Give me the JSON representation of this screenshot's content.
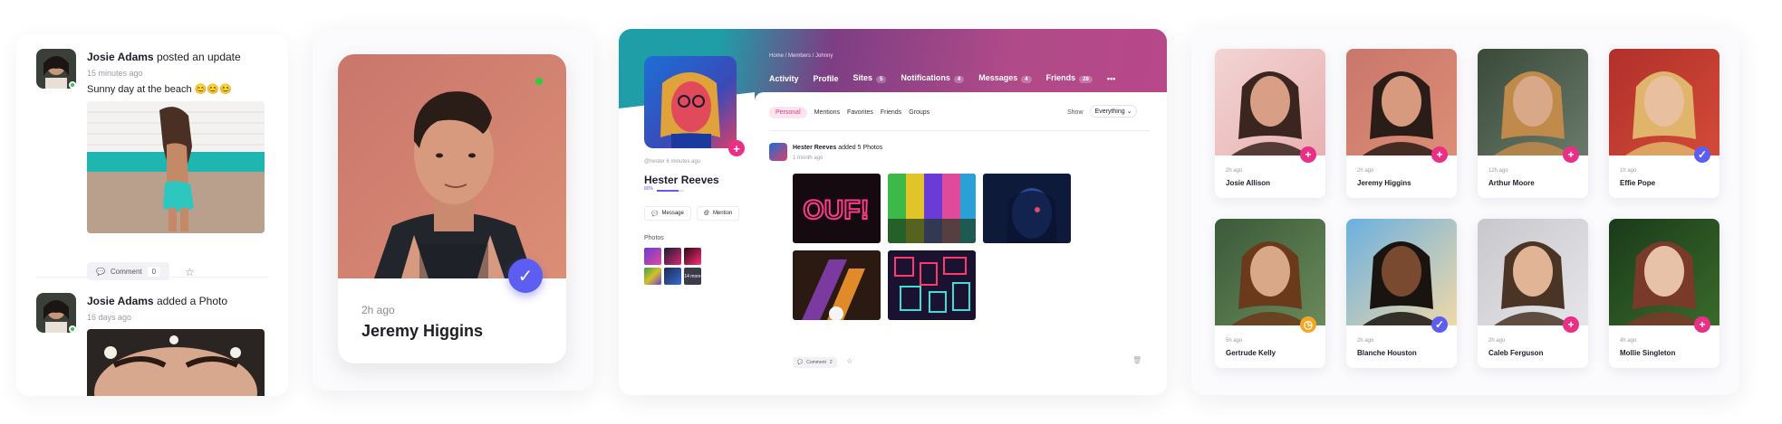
{
  "colors": {
    "accent_pink": "#ea2f86",
    "accent_blue": "#5b5ef0",
    "accent_orange": "#f5a623",
    "online": "#2ecc40"
  },
  "feed": {
    "items": [
      {
        "author": "Josie Adams",
        "action": "posted an update",
        "time": "15 minutes ago",
        "text": "Sunny day at the beach",
        "emoji": "😊😊😊",
        "comment_label": "Comment",
        "comment_count": "0"
      },
      {
        "author": "Josie Adams",
        "action": "added a Photo",
        "time": "16 days ago"
      }
    ]
  },
  "single_card": {
    "time": "2h ago",
    "name": "Jeremy Higgins",
    "badge_icon": "check-icon"
  },
  "profile": {
    "breadcrumb": "Home  /  Members  /  Johnny",
    "tabs": [
      {
        "label": "Activity",
        "count": ""
      },
      {
        "label": "Profile",
        "count": ""
      },
      {
        "label": "Sites",
        "count": "5"
      },
      {
        "label": "Notifications",
        "count": "4"
      },
      {
        "label": "Messages",
        "count": "4"
      },
      {
        "label": "Friends",
        "count": "28"
      },
      {
        "label": "•••",
        "count": ""
      }
    ],
    "subtabs": [
      "Personal",
      "Mentions",
      "Favorites",
      "Friends",
      "Groups"
    ],
    "show_label": "Show",
    "show_value": "Everything ⌄",
    "handle": "@hester 6 minutes ago",
    "name": "Hester Reeves",
    "progress": 0.8,
    "progress_label": "80%",
    "message_label": "Message",
    "mention_label": "Mention",
    "photos_label": "Photos",
    "more_photos": "14 more",
    "post": {
      "author": "Hester Reeves",
      "action": "added 5 Photos",
      "time": "1 month ago",
      "comment_label": "Comment",
      "comment_count": "2"
    }
  },
  "grid": {
    "members": [
      {
        "time": "2h ago",
        "name": "Josie Allison",
        "badge": "plus"
      },
      {
        "time": "2h ago",
        "name": "Jeremy Higgins",
        "badge": "plus"
      },
      {
        "time": "12h ago",
        "name": "Arthur Moore",
        "badge": "plus"
      },
      {
        "time": "1h ago",
        "name": "Effie Pope",
        "badge": "check"
      },
      {
        "time": "5h ago",
        "name": "Gertrude Kelly",
        "badge": "clock"
      },
      {
        "time": "2h ago",
        "name": "Blanche Houston",
        "badge": "check"
      },
      {
        "time": "2h ago",
        "name": "Caleb Ferguson",
        "badge": "plus"
      },
      {
        "time": "4h ago",
        "name": "Mollie Singleton",
        "badge": "plus"
      }
    ]
  }
}
